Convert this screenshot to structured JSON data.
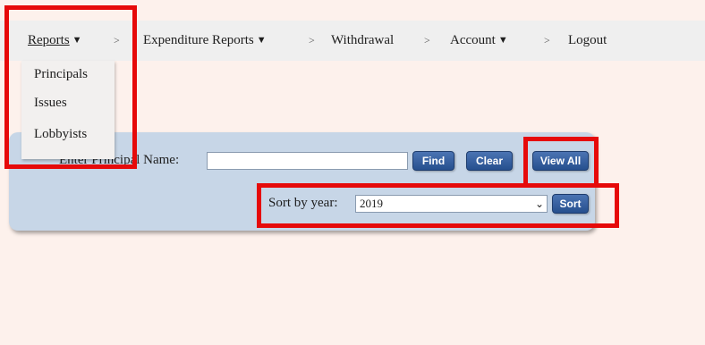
{
  "nav": {
    "reports": "Reports",
    "sep1": ">",
    "expenditure": "Expenditure Reports",
    "sep2": ">",
    "withdrawal": "Withdrawal",
    "sep3": ">",
    "account": "Account",
    "sep4": ">",
    "logout": "Logout",
    "caret": "▼"
  },
  "reports_menu": {
    "items": [
      "Principals",
      "Issues",
      "Lobbyists"
    ]
  },
  "search": {
    "label": "Enter Principal Name:",
    "value": "",
    "find_label": "Find",
    "clear_label": "Clear",
    "view_all_label": "View All"
  },
  "sort": {
    "label": "Sort by year:",
    "selected": "2019",
    "button_label": "Sort"
  },
  "colors": {
    "highlight": "#e60a0a",
    "button": "#2f5a9e",
    "panel": "#c7d6e7"
  }
}
